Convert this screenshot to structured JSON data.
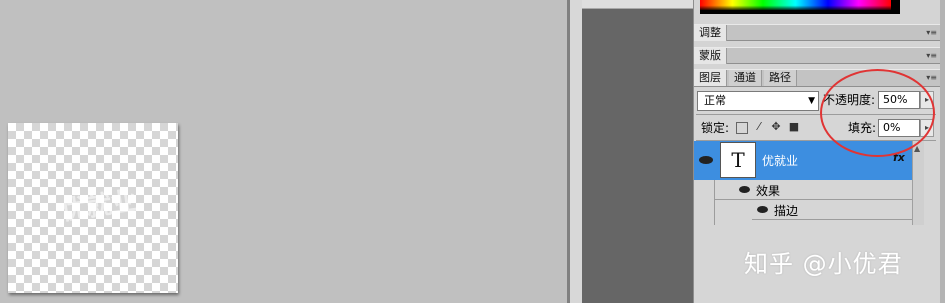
{
  "canvas": {
    "ghost_text": "优就业"
  },
  "panels": {
    "adjust": {
      "label": "调整"
    },
    "masks": {
      "label": "蒙版"
    },
    "layers": {
      "tabs": [
        "图层",
        "通道",
        "路径"
      ],
      "blend_mode": "正常",
      "opacity_label": "不透明度:",
      "opacity_value": "50%",
      "lock_label": "锁定:",
      "fill_label": "填充:",
      "fill_value": "0%",
      "layer": {
        "thumb_letter": "T",
        "name": "优就业",
        "fx_badge": "fx",
        "effects_label": "效果",
        "stroke_label": "描边"
      }
    }
  },
  "icons": {
    "panel_menu": "panel-menu-icon",
    "eye": "eye-icon",
    "lock": [
      "lock-transparent-icon",
      "lock-brush-icon",
      "lock-move-icon",
      "lock-all-icon"
    ]
  },
  "colors": {
    "selected_layer": "#3d8ee0",
    "annotation_circle": "#e03434"
  },
  "watermark": "知乎 @小优君"
}
